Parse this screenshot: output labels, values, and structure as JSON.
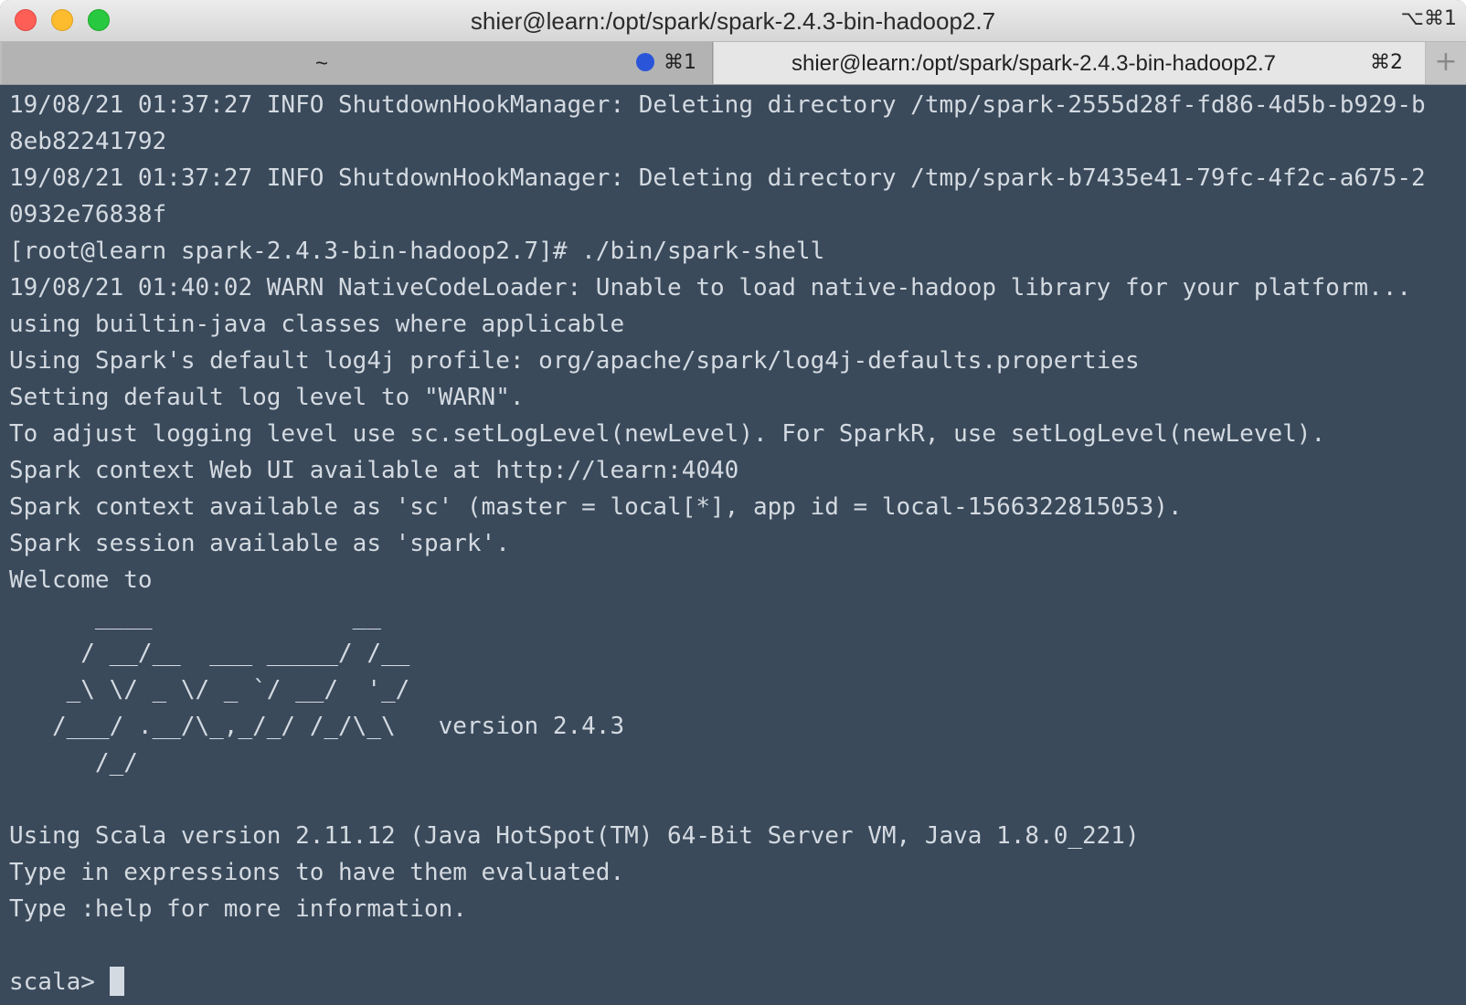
{
  "window": {
    "title": "shier@learn:/opt/spark/spark-2.4.3-bin-hadoop2.7",
    "shortcut": "⌥⌘1"
  },
  "tabs": [
    {
      "label": "~",
      "shortcut": "⌘1",
      "active": false,
      "indicator_color": "#2a55d9"
    },
    {
      "label": "shier@learn:/opt/spark/spark-2.4.3-bin-hadoop2.7",
      "shortcut": "⌘2",
      "active": true
    }
  ],
  "new_tab_label": "+",
  "terminal": {
    "lines": [
      "19/08/21 01:37:27 INFO ShutdownHookManager: Deleting directory /tmp/spark-2555d28f-fd86-4d5b-b929-b",
      "8eb82241792",
      "19/08/21 01:37:27 INFO ShutdownHookManager: Deleting directory /tmp/spark-b7435e41-79fc-4f2c-a675-2",
      "0932e76838f",
      "[root@learn spark-2.4.3-bin-hadoop2.7]# ./bin/spark-shell",
      "19/08/21 01:40:02 WARN NativeCodeLoader: Unable to load native-hadoop library for your platform...",
      "using builtin-java classes where applicable",
      "Using Spark's default log4j profile: org/apache/spark/log4j-defaults.properties",
      "Setting default log level to \"WARN\".",
      "To adjust logging level use sc.setLogLevel(newLevel). For SparkR, use setLogLevel(newLevel).",
      "Spark context Web UI available at http://learn:4040",
      "Spark context available as 'sc' (master = local[*], app id = local-1566322815053).",
      "Spark session available as 'spark'.",
      "Welcome to",
      "      ____              __",
      "     / __/__  ___ _____/ /__",
      "    _\\ \\/ _ \\/ _ `/ __/  '_/",
      "   /___/ .__/\\_,_/_/ /_/\\_\\   version 2.4.3",
      "      /_/",
      "",
      "Using Scala version 2.11.12 (Java HotSpot(TM) 64-Bit Server VM, Java 1.8.0_221)",
      "Type in expressions to have them evaluated.",
      "Type :help for more information.",
      ""
    ],
    "prompt": "scala> "
  },
  "colors": {
    "terminal_bg": "#3a4a5b",
    "terminal_fg": "#d4dae1",
    "close": "#fd5f57",
    "minimize": "#fdbc2e",
    "maximize": "#28c840"
  }
}
